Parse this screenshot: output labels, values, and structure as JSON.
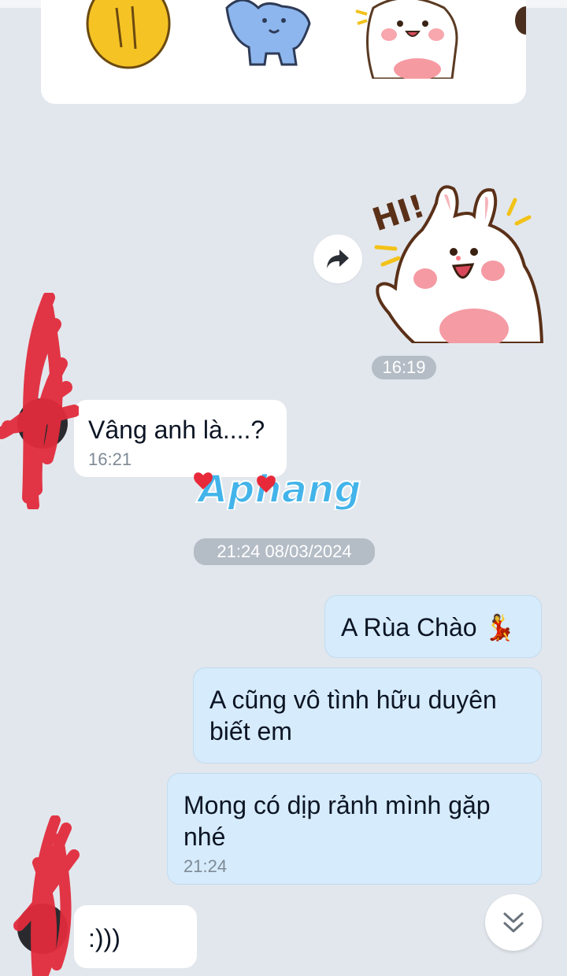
{
  "sticker_picker": {
    "stickers": [
      "hand-sticker",
      "blue-cat-sticker",
      "bunny-sticker",
      "brown-sticker"
    ]
  },
  "forward_icon": "share-arrow-icon",
  "hi_sticker": {
    "text": "HI!"
  },
  "messages": [
    {
      "time": "16:19",
      "kind": "time-divider"
    },
    {
      "direction": "incoming",
      "text": "Vâng anh là....?",
      "time": "16:21"
    },
    {
      "time": "21:24 08/03/2024",
      "kind": "date-divider"
    },
    {
      "direction": "outgoing",
      "text": "A Rùa Chào 💃"
    },
    {
      "direction": "outgoing",
      "text": "A cũng vô tình hữu duyên biết em"
    },
    {
      "direction": "outgoing",
      "text": "Mong có dịp rảnh mình gặp nhé",
      "time": "21:24"
    },
    {
      "direction": "incoming",
      "text": ":)))"
    }
  ],
  "watermark": {
    "text": "Aphang"
  },
  "scroll_down_icon": "double-chevron-down-icon",
  "colors": {
    "background": "#e2e7ed",
    "incoming_bubble": "#ffffff",
    "outgoing_bubble": "#d6ebfb",
    "scribble": "#e02b3c"
  }
}
